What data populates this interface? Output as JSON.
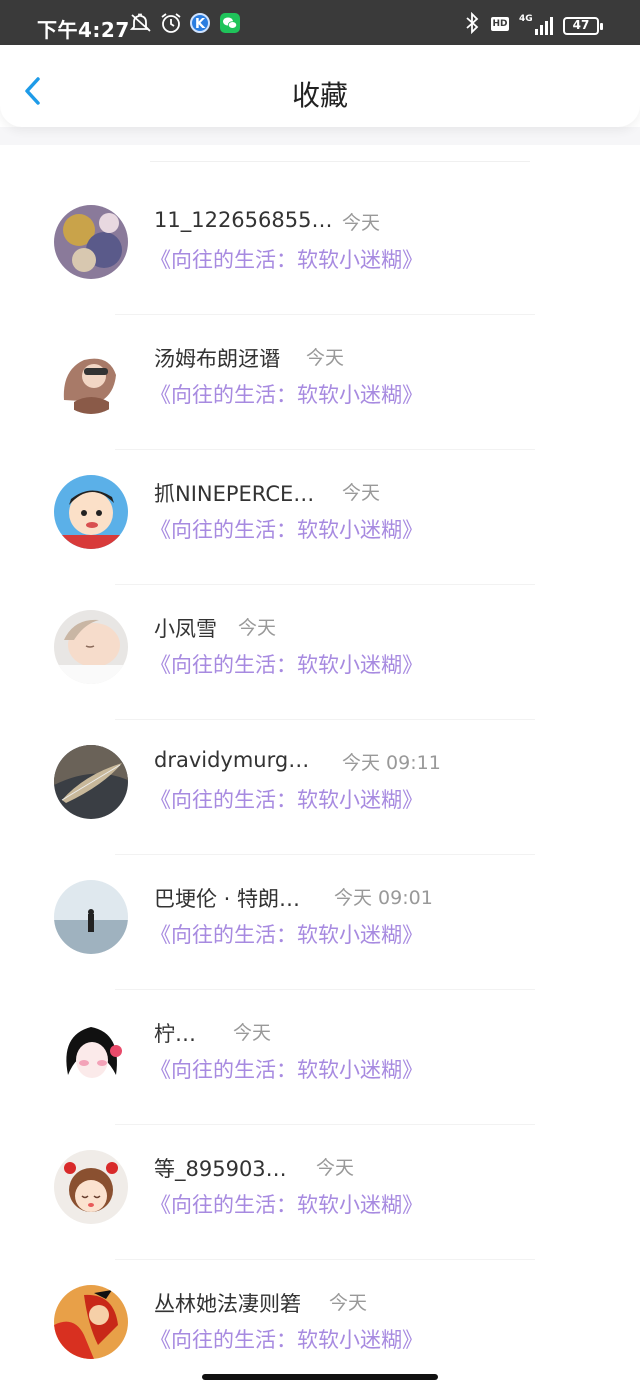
{
  "status_bar": {
    "time": "下午4:27",
    "hd": "HD",
    "network": "4G",
    "battery": "47"
  },
  "header": {
    "title": "收藏",
    "back_icon": "chevron-left-icon"
  },
  "list": {
    "items": [
      {
        "name": "11_122656855…",
        "time": "今天",
        "subtitle": "《向往的生活：软软小迷糊》"
      },
      {
        "name": "汤姆布朗迓谮",
        "time": "今天",
        "subtitle": "《向往的生活：软软小迷糊》"
      },
      {
        "name": "抓NINEPERCE…",
        "time": "今天",
        "subtitle": "《向往的生活：软软小迷糊》"
      },
      {
        "name": "小凤雪",
        "time": "今天",
        "subtitle": "《向往的生活：软软小迷糊》"
      },
      {
        "name": "dravidymurg…",
        "time": "今天 09:11",
        "subtitle": "《向往的生活：软软小迷糊》"
      },
      {
        "name": "巴埂伦 · 特朗…",
        "time": "今天 09:01",
        "subtitle": "《向往的生活：软软小迷糊》"
      },
      {
        "name": "柠…",
        "time": "今天",
        "subtitle": "《向往的生活：软软小迷糊》"
      },
      {
        "name": "等_895903…",
        "time": "今天",
        "subtitle": "《向往的生活：软软小迷糊》"
      },
      {
        "name": "丛林她法凄则箬",
        "time": "今天",
        "subtitle": "《向往的生活：软软小迷糊》"
      }
    ]
  },
  "colors": {
    "accent_blue": "#1e9be8",
    "subtitle_purple": "#a78ae0"
  }
}
